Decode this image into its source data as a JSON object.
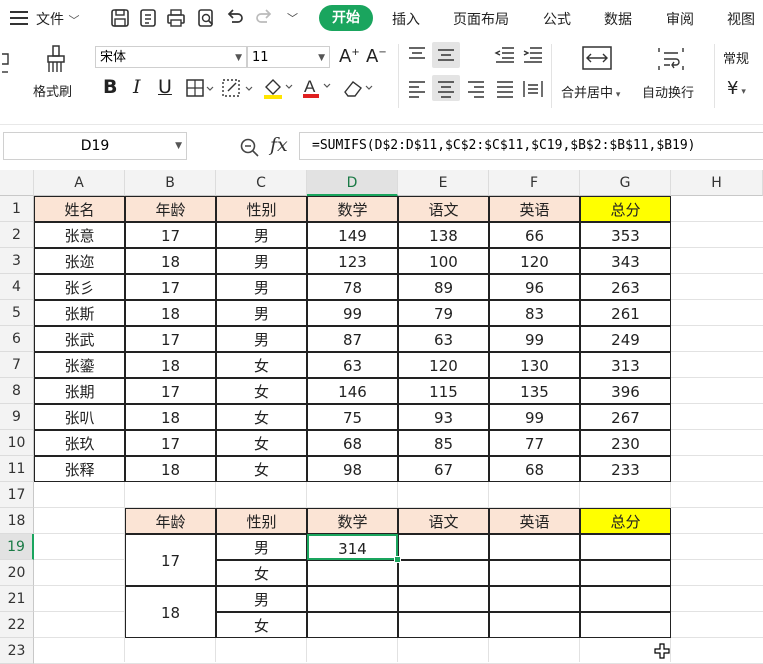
{
  "menu": {
    "file_label": "文件",
    "tabs": [
      "开始",
      "插入",
      "页面布局",
      "公式",
      "数据",
      "审阅",
      "视图"
    ],
    "active_tab": "开始"
  },
  "toolbar": {
    "format_painter": "格式刷",
    "font_name": "宋体",
    "font_size": "11",
    "merge_center": "合并居中",
    "wrap_text": "自动换行",
    "number_format": "常规",
    "currency": "¥"
  },
  "formula_bar": {
    "name_box": "D19",
    "fx_label": "fx",
    "formula": "=SUMIFS(D$2:D$11,$C$2:$C$11,$C19,$B$2:$B$11,$B19)"
  },
  "columns": [
    "A",
    "B",
    "C",
    "D",
    "E",
    "F",
    "G",
    "H"
  ],
  "rows": [
    "1",
    "2",
    "3",
    "4",
    "5",
    "6",
    "7",
    "8",
    "9",
    "10",
    "11",
    "17",
    "18",
    "19",
    "20",
    "21",
    "22",
    "23"
  ],
  "table1": {
    "headers": [
      "姓名",
      "年龄",
      "性别",
      "数学",
      "语文",
      "英语",
      "总分"
    ],
    "rows": [
      [
        "张意",
        "17",
        "男",
        "149",
        "138",
        "66",
        "353"
      ],
      [
        "张迩",
        "18",
        "男",
        "123",
        "100",
        "120",
        "343"
      ],
      [
        "张彡",
        "17",
        "男",
        "78",
        "89",
        "96",
        "263"
      ],
      [
        "张斯",
        "18",
        "男",
        "99",
        "79",
        "83",
        "261"
      ],
      [
        "张武",
        "17",
        "男",
        "87",
        "63",
        "99",
        "249"
      ],
      [
        "张鎏",
        "18",
        "女",
        "63",
        "120",
        "130",
        "313"
      ],
      [
        "张期",
        "17",
        "女",
        "146",
        "115",
        "135",
        "396"
      ],
      [
        "张叭",
        "18",
        "女",
        "75",
        "93",
        "99",
        "267"
      ],
      [
        "张玖",
        "17",
        "女",
        "68",
        "85",
        "77",
        "230"
      ],
      [
        "张释",
        "18",
        "女",
        "98",
        "67",
        "68",
        "233"
      ]
    ]
  },
  "table2": {
    "headers": [
      "年龄",
      "性别",
      "数学",
      "语文",
      "英语",
      "总分"
    ],
    "age_groups": [
      "17",
      "18"
    ],
    "genders": [
      "男",
      "女",
      "男",
      "女"
    ],
    "d19_value": "314"
  },
  "colors": {
    "header_fill": "#fbe4d5",
    "total_fill": "#ffff00",
    "accent": "#1aa55e"
  }
}
